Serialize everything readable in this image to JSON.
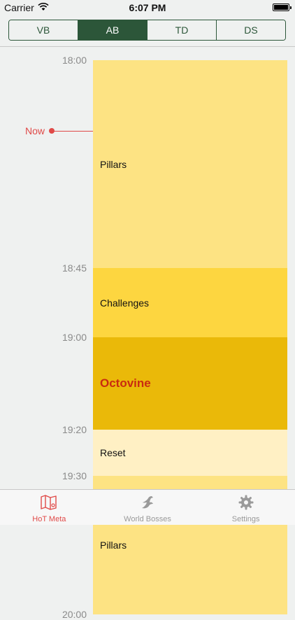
{
  "status_bar": {
    "carrier": "Carrier",
    "time": "6:07 PM"
  },
  "segments": [
    {
      "label": "VB",
      "selected": false
    },
    {
      "label": "AB",
      "selected": true
    },
    {
      "label": "TD",
      "selected": false
    },
    {
      "label": "DS",
      "selected": false
    }
  ],
  "timeline": {
    "time_labels": [
      "18:00",
      "18:45",
      "19:00",
      "19:20",
      "19:30",
      "20:00"
    ],
    "now_label": "Now",
    "events": [
      {
        "name": "Pillars",
        "start": "18:00",
        "end": "18:45",
        "color": "#fde383",
        "text_color": "#111111",
        "bold": false
      },
      {
        "name": "Challenges",
        "start": "18:45",
        "end": "19:00",
        "color": "#fdd640",
        "text_color": "#111111",
        "bold": false
      },
      {
        "name": "Octovine",
        "start": "19:00",
        "end": "19:20",
        "color": "#eab909",
        "text_color": "#c92b10",
        "bold": true
      },
      {
        "name": "Reset",
        "start": "19:20",
        "end": "19:30",
        "color": "#fff0c4",
        "text_color": "#111111",
        "bold": false
      },
      {
        "name": "Pillars",
        "start": "19:30",
        "end": "20:00",
        "color": "#fde383",
        "text_color": "#111111",
        "bold": false
      }
    ]
  },
  "tab_bar": {
    "tabs": [
      {
        "label": "HoT Meta",
        "icon": "map-icon",
        "selected": true
      },
      {
        "label": "World Bosses",
        "icon": "dragon-icon",
        "selected": false
      },
      {
        "label": "Settings",
        "icon": "gear-icon",
        "selected": false
      }
    ]
  },
  "colors": {
    "accent_green": "#2c5639",
    "now_red": "#e04a48",
    "active_tab_red": "#e04a48"
  }
}
